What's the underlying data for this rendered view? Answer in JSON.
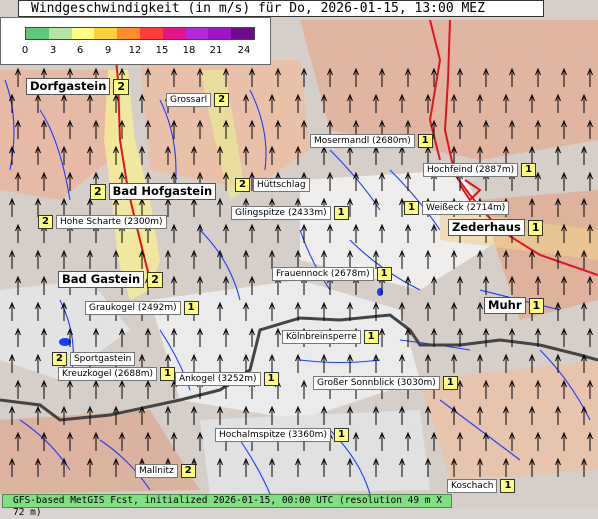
{
  "title": "Windgeschwindigkeit (in m/s) für Do, 2026-01-15, 13:00 MEZ",
  "legend": {
    "ticks": [
      "0",
      "3",
      "6",
      "9",
      "12",
      "15",
      "18",
      "21",
      "24"
    ],
    "colors": [
      "#5ec878",
      "#b4e6a0",
      "#ffff80",
      "#ffd23c",
      "#ff8c28",
      "#ff3c3c",
      "#e6148c",
      "#b428dc",
      "#a014c8",
      "#6e0a8c"
    ]
  },
  "footer": "GFS-based MetGIS Fcst, initialized 2026-01-15, 00:00 UTC  (resolution 49 m X 72 m)",
  "locations": [
    {
      "name": "Dorfgastein",
      "value": "2",
      "big": true
    },
    {
      "name": "Grossarl",
      "value": "2",
      "big": false
    },
    {
      "name": "Mosermandl (2680m)",
      "value": "1",
      "big": false
    },
    {
      "name": "Hochfeind (2887m)",
      "value": "1",
      "big": false
    },
    {
      "name": "Bad Hofgastein",
      "value": "2",
      "big": true
    },
    {
      "name": "Hüttschlag",
      "value": "2",
      "big": false
    },
    {
      "name": "Glingspitze (2433m)",
      "value": "1",
      "big": false
    },
    {
      "name": "Weißeck (2714m)",
      "value": "1",
      "big": false
    },
    {
      "name": "Hohe Scharte (2300m)",
      "value": "2",
      "big": false
    },
    {
      "name": "Zederhaus",
      "value": "1",
      "big": true
    },
    {
      "name": "Frauennock (2678m)",
      "value": "1",
      "big": false
    },
    {
      "name": "Bad Gastein",
      "value": "2",
      "big": true
    },
    {
      "name": "Graukogel (2492m)",
      "value": "1",
      "big": false
    },
    {
      "name": "Muhr",
      "value": "1",
      "big": true
    },
    {
      "name": "Kölnbreinsperre",
      "value": "1",
      "big": false
    },
    {
      "name": "Sportgastein",
      "value": "2",
      "big": false
    },
    {
      "name": "Kreuzkogel (2688m)",
      "value": "1",
      "big": false
    },
    {
      "name": "Ankogel (3252m)",
      "value": "1",
      "big": false
    },
    {
      "name": "Großer Sonnblick (3030m)",
      "value": "1",
      "big": false
    },
    {
      "name": "Hochalmspitze (3360m)",
      "value": "1",
      "big": false
    },
    {
      "name": "Mallnitz",
      "value": "2",
      "big": false
    },
    {
      "name": "Koschach",
      "value": "1",
      "big": false
    }
  ]
}
